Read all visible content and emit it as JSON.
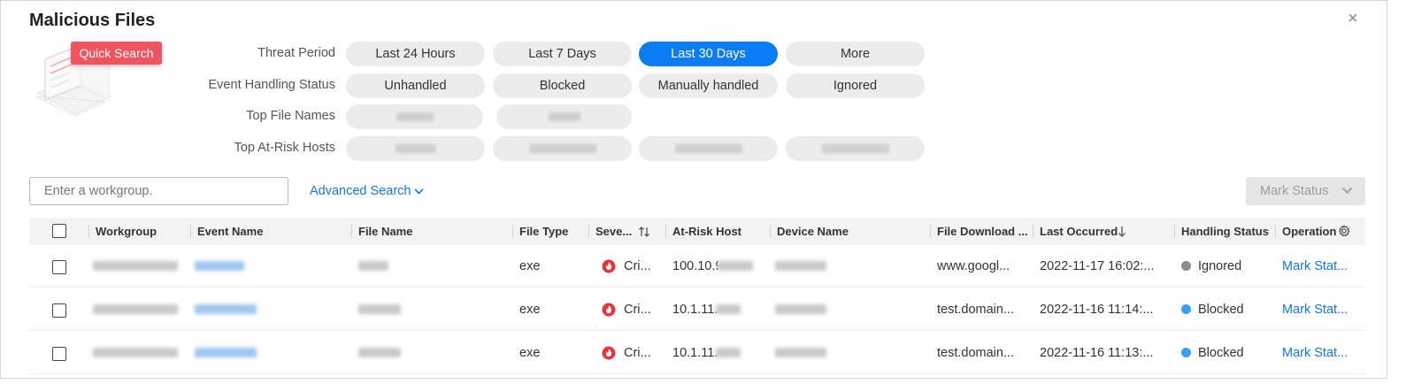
{
  "dialog": {
    "title": "Malicious Files",
    "close_icon": "×"
  },
  "quick_search": {
    "tag": "Quick Search",
    "illustration_icon": "document-monitor-illustration"
  },
  "filters": {
    "threat_period": {
      "label": "Threat Period",
      "options": [
        "Last 24 Hours",
        "Last 7 Days",
        "Last 30 Days",
        "More"
      ],
      "selected": "Last 30 Days"
    },
    "event_handling_status": {
      "label": "Event Handling Status",
      "options": [
        "Unhandled",
        "Blocked",
        "Manually handled",
        "Ignored"
      ]
    },
    "top_file_names": {
      "label": "Top File Names"
    },
    "top_at_risk_hosts": {
      "label": "Top At-Risk Hosts"
    }
  },
  "toolbar": {
    "search_placeholder": "Enter a workgroup.",
    "advanced_search": "Advanced Search",
    "mark_status": "Mark Status"
  },
  "table": {
    "columns": {
      "workgroup": "Workgroup",
      "event_name": "Event Name",
      "file_name": "File Name",
      "file_type": "File Type",
      "severity": "Seve...",
      "at_risk_host": "At-Risk Host",
      "device_name": "Device Name",
      "file_download": "File Download ...",
      "last_occurred": "Last Occurred",
      "handling_status": "Handling Status",
      "operation": "Operation"
    },
    "rows": [
      {
        "file_type": "exe",
        "severity": "Cri...",
        "at_risk_host": "100.10.9",
        "file_download": "www.googl...",
        "last_occurred": "2022-11-17 16:02:...",
        "handling_status": "Ignored",
        "status_color": "#8c8c8c",
        "operation": "Mark Stat..."
      },
      {
        "file_type": "exe",
        "severity": "Cri...",
        "at_risk_host": "10.1.11.",
        "file_download": "test.domain...",
        "last_occurred": "2022-11-16 11:14:...",
        "handling_status": "Blocked",
        "status_color": "#3aa0ee",
        "operation": "Mark Stat..."
      },
      {
        "file_type": "exe",
        "severity": "Cri...",
        "at_risk_host": "10.1.11.",
        "file_download": "test.domain...",
        "last_occurred": "2022-11-16 11:13:...",
        "handling_status": "Blocked",
        "status_color": "#3aa0ee",
        "operation": "Mark Stat..."
      }
    ]
  },
  "colors": {
    "accent": "#0a7cf4",
    "link": "#1677d9",
    "severity_critical": "#e8343c",
    "quick_search_tag": "#f0545f"
  }
}
